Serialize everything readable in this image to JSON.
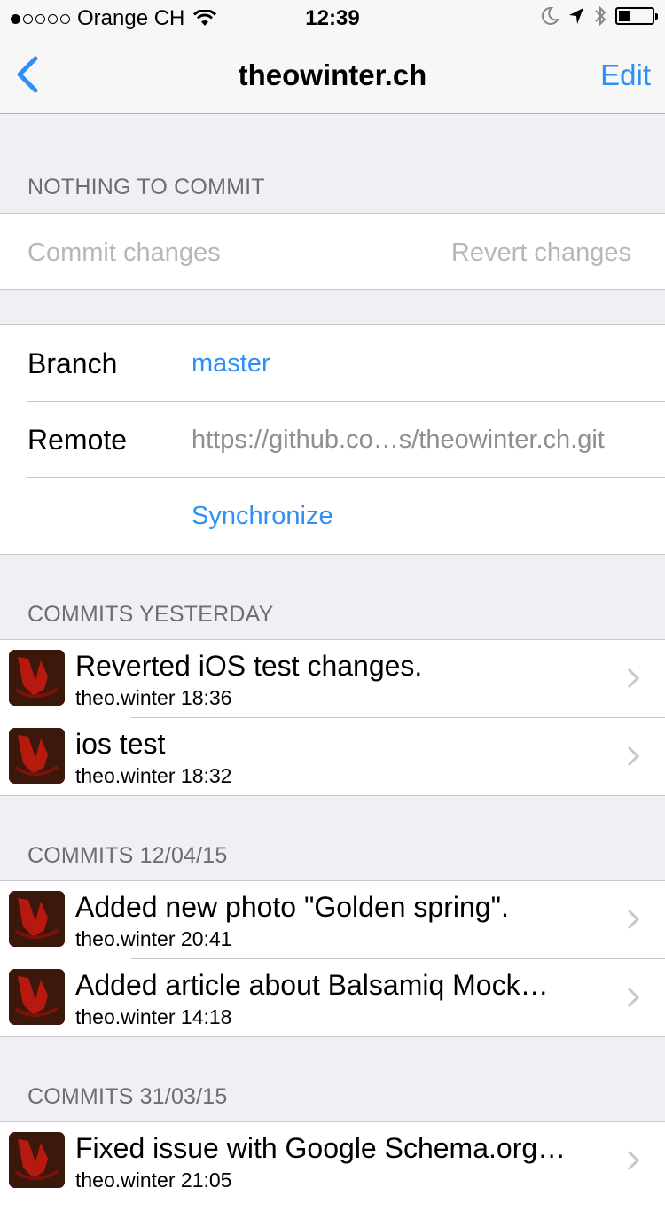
{
  "status_bar": {
    "carrier": "Orange CH",
    "time": "12:39"
  },
  "nav": {
    "title": "theowinter.ch",
    "edit_label": "Edit"
  },
  "working_copy": {
    "header": "NOTHING TO COMMIT",
    "commit_label": "Commit changes",
    "revert_label": "Revert changes"
  },
  "repo": {
    "branch_label": "Branch",
    "branch_value": "master",
    "remote_label": "Remote",
    "remote_value": "https://github.co…s/theowinter.ch.git",
    "sync_label": "Synchronize"
  },
  "commit_groups": [
    {
      "header": "COMMITS YESTERDAY",
      "commits": [
        {
          "title": "Reverted iOS test changes.",
          "meta": "theo.winter 18:36"
        },
        {
          "title": "ios test",
          "meta": "theo.winter 18:32"
        }
      ]
    },
    {
      "header": "COMMITS 12/04/15",
      "commits": [
        {
          "title": "Added new photo \"Golden spring\".",
          "meta": "theo.winter 20:41"
        },
        {
          "title": "Added article about Balsamiq Mock…",
          "meta": "theo.winter 14:18"
        }
      ]
    },
    {
      "header": "COMMITS 31/03/15",
      "commits": [
        {
          "title": "Fixed issue with Google Schema.org…",
          "meta": "theo.winter 21:05"
        }
      ]
    }
  ],
  "colors": {
    "accent": "#2f8ff5",
    "background": "#efeff4",
    "disabled_text": "#b7b7bb"
  },
  "icons": [
    "signal-dots",
    "wifi-icon",
    "moon-icon",
    "location-arrow-icon",
    "bluetooth-icon",
    "battery-icon",
    "back-chevron-icon",
    "avatar-image",
    "chevron-right-icon"
  ]
}
